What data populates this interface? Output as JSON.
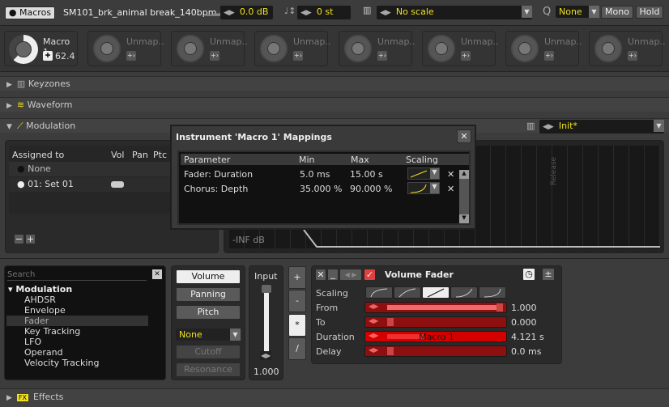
{
  "topbar": {
    "macros_label": "Macros",
    "sample_name": "SM101_brk_animal break_140bpm",
    "volume": "0.0 dB",
    "transpose": "0 st",
    "scale": "No scale",
    "quantize_label": "Q",
    "quantize": "None",
    "mono": "Mono",
    "hold": "Hold"
  },
  "macros": [
    {
      "label": "Macro 1",
      "value": "62.4",
      "fill": 0.62
    },
    {
      "label": "Unmap.."
    },
    {
      "label": "Unmap.."
    },
    {
      "label": "Unmap.."
    },
    {
      "label": "Unmap.."
    },
    {
      "label": "Unmap.."
    },
    {
      "label": "Unmap.."
    },
    {
      "label": "Unmap.."
    }
  ],
  "sections": {
    "keyzones": "Keyzones",
    "waveform": "Waveform",
    "modulation": "Modulation",
    "effects": "Effects",
    "effects_badge": "FX"
  },
  "modulation": {
    "preset": "Init*",
    "headers": [
      "Assigned to",
      "Vol",
      "Pan",
      "Ptc"
    ],
    "sets": [
      "None",
      "01: Set 01"
    ],
    "graph_floor": "-INF dB",
    "graph_release": "Release"
  },
  "dialog": {
    "title": "Instrument 'Macro 1' Mappings",
    "headers": [
      "Parameter",
      "Min",
      "Max",
      "Scaling"
    ],
    "rows": [
      {
        "param": "Fader: Duration",
        "min": "5.0 ms",
        "max": "15.00 s"
      },
      {
        "param": "Chorus: Depth",
        "min": "35.000 %",
        "max": "90.000 %"
      }
    ]
  },
  "browser": {
    "search_placeholder": "Search",
    "group": "Modulation",
    "items": [
      "AHDSR",
      "Envelope",
      "Fader",
      "Key Tracking",
      "LFO",
      "Operand",
      "Velocity Tracking"
    ],
    "selected": "Fader"
  },
  "targets": {
    "buttons": [
      "Volume",
      "Panning",
      "Pitch"
    ],
    "filter_select": "None",
    "filter_buttons": [
      "Cutoff",
      "Resonance"
    ]
  },
  "input": {
    "label": "Input",
    "value": "1.000",
    "level": 1.0
  },
  "operators": [
    "+",
    "-",
    "*",
    "/"
  ],
  "device": {
    "title": "Volume Fader",
    "scaling_label": "Scaling",
    "params": [
      {
        "label": "From",
        "value": "1.000",
        "fill": 1.0
      },
      {
        "label": "To",
        "value": "0.000",
        "fill": 0.0
      },
      {
        "label": "Duration",
        "value": "4.121 s",
        "fill": 0.27,
        "overlay": "Macro 1"
      },
      {
        "label": "Delay",
        "value": "0.0 ms",
        "fill": 0.0
      }
    ]
  },
  "colors": {
    "accent": "#f0e020",
    "slider": "#8d0f0f",
    "slider_active": "#d40000"
  }
}
